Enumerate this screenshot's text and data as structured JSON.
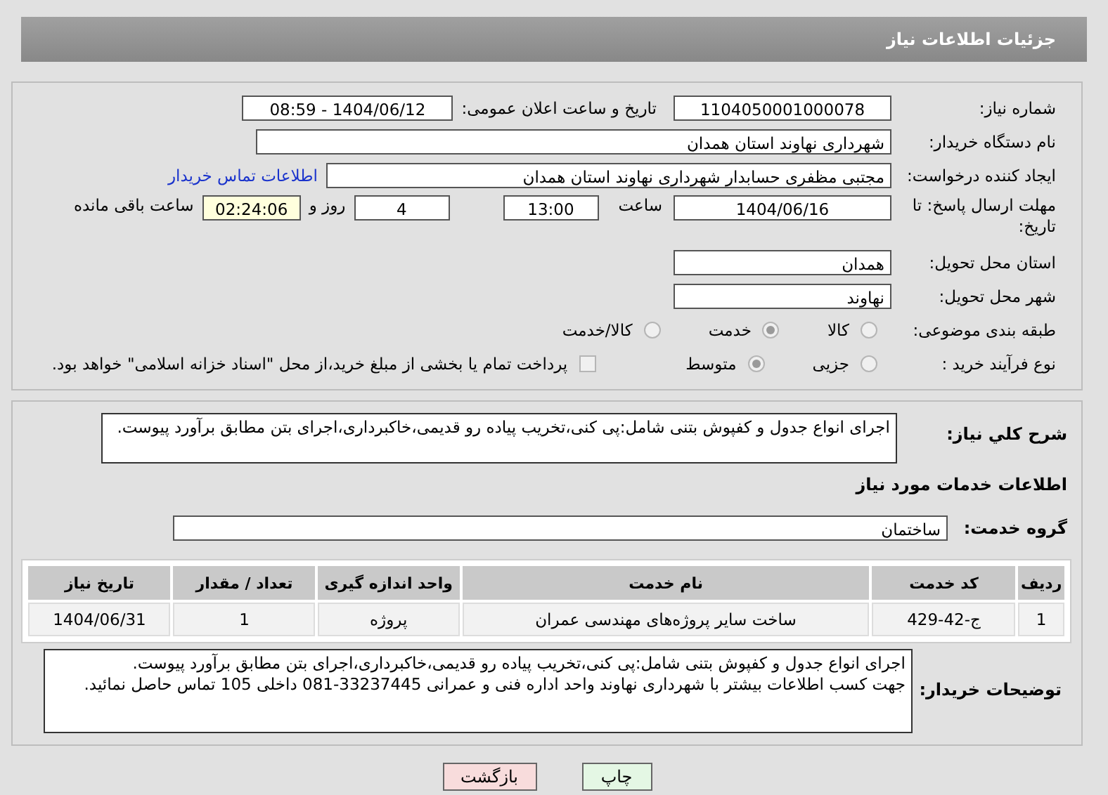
{
  "header": {
    "title": "جزئیات اطلاعات نیاز"
  },
  "need_number": {
    "label": "شماره نیاز:",
    "value": "1104050001000078"
  },
  "announce": {
    "label": "تاریخ و ساعت اعلان عمومی:",
    "value": "1404/06/12 - 08:59"
  },
  "buyer_org": {
    "label": "نام دستگاه خریدار:",
    "value": "شهرداری نهاوند استان همدان"
  },
  "requester": {
    "label": "ایجاد کننده درخواست:",
    "value": "مجتبی مظفری حسابدار شهرداری نهاوند استان همدان",
    "link": "اطلاعات تماس خریدار"
  },
  "deadline": {
    "label": "مهلت ارسال پاسخ: تا تاریخ:",
    "date": "1404/06/16",
    "time_label": "ساعت",
    "time": "13:00",
    "days": "4",
    "days_label": "روز و",
    "remaining": "02:24:06",
    "remaining_label": "ساعت باقی مانده"
  },
  "province": {
    "label": "استان محل تحویل:",
    "value": "همدان"
  },
  "city": {
    "label": "شهر محل تحویل:",
    "value": "نهاوند"
  },
  "category": {
    "label": "طبقه بندی موضوعی:",
    "options": [
      {
        "label": "کالا",
        "selected": false
      },
      {
        "label": "خدمت",
        "selected": true
      },
      {
        "label": "کالا/خدمت",
        "selected": false
      }
    ]
  },
  "purchase_type": {
    "label": "نوع فرآیند خرید :",
    "options": [
      {
        "label": "جزیی",
        "selected": false
      },
      {
        "label": "متوسط",
        "selected": true
      }
    ],
    "payment": {
      "checked": false,
      "label": "پرداخت تمام یا بخشی از مبلغ خرید،از محل \"اسناد خزانه اسلامی\" خواهد بود."
    }
  },
  "description": {
    "label": "شرح کلي نياز:",
    "value": "اجرای انواع جدول و کفپوش بتنی شامل:پی کنی،تخریب پیاده رو قدیمی،خاکبرداری،اجرای بتن مطابق برآورد پیوست."
  },
  "services_heading": "اطلاعات خدمات مورد نیاز",
  "service_group": {
    "label": "گروه خدمت:",
    "value": "ساختمان"
  },
  "table": {
    "columns": [
      "ردیف",
      "کد خدمت",
      "نام خدمت",
      "واحد اندازه گیری",
      "تعداد / مقدار",
      "تاریخ نیاز"
    ],
    "rows": [
      [
        "1",
        "ج-42-429",
        "ساخت سایر پروژه‌های مهندسی عمران",
        "پروژه",
        "1",
        "1404/06/31"
      ]
    ]
  },
  "buyer_notes": {
    "label": "توضیحات خریدار:",
    "lines": [
      "اجرای انواع جدول و کفپوش بتنی شامل:پی کنی،تخریب پیاده رو قدیمی،خاکبرداری،اجرای بتن مطابق برآورد پیوست.",
      "جهت کسب اطلاعات بیشتر با شهرداری نهاوند واحد اداره فنی و عمرانی 33237445-081 داخلی 105 تماس حاصل نمائید."
    ]
  },
  "buttons": [
    {
      "kind": "print",
      "label": "چاپ"
    },
    {
      "kind": "back",
      "label": "بازگشت"
    }
  ]
}
